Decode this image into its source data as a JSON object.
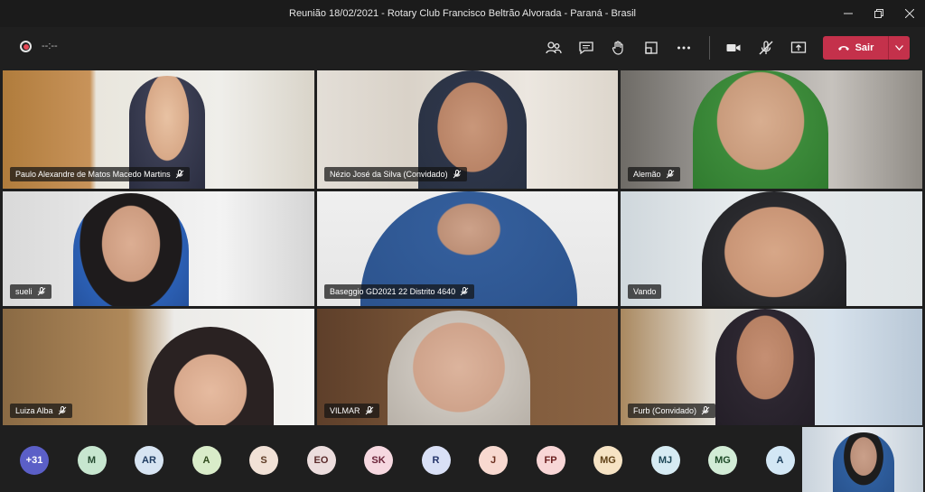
{
  "window": {
    "title": "Reunião 18/02/2021 - Rotary Club Francisco Beltrão Alvorada - Paraná - Brasil"
  },
  "toolbar": {
    "timer": "--:--",
    "leave_label": "Sair"
  },
  "participants": [
    {
      "name": "Paulo Alexandre de Matos Macedo Martins"
    },
    {
      "name": "Nézio José da Silva (Convidado)"
    },
    {
      "name": "Alemão"
    },
    {
      "name": "sueli"
    },
    {
      "name": "Baseggio GD2021 22 Distrito 4640"
    },
    {
      "name": "Vando"
    },
    {
      "name": "Luiza Alba"
    },
    {
      "name": "VILMAR"
    },
    {
      "name": "Furb (Convidado)"
    }
  ],
  "roster": [
    {
      "initials": "+31",
      "bg": "#5b5fc7",
      "fg": "#ffffff"
    },
    {
      "initials": "M",
      "bg": "#c7e6cf",
      "fg": "#24492e"
    },
    {
      "initials": "AR",
      "bg": "#d7e4f2",
      "fg": "#1e3a5f"
    },
    {
      "initials": "A",
      "bg": "#d9ecc9",
      "fg": "#2f4a1c"
    },
    {
      "initials": "S",
      "bg": "#f1e1d6",
      "fg": "#5c3a24"
    },
    {
      "initials": "EO",
      "bg": "#ecdddd",
      "fg": "#5a2b2b"
    },
    {
      "initials": "SK",
      "bg": "#f6d8e0",
      "fg": "#6a2338"
    },
    {
      "initials": "R",
      "bg": "#d9e0f6",
      "fg": "#24346a"
    },
    {
      "initials": "J",
      "bg": "#f8d9d0",
      "fg": "#6a2e1d"
    },
    {
      "initials": "FP",
      "bg": "#f8d6d6",
      "fg": "#6a1e1e"
    },
    {
      "initials": "MG",
      "bg": "#f6e3c4",
      "fg": "#5f4016"
    },
    {
      "initials": "MJ",
      "bg": "#d6ebf3",
      "fg": "#1c4656"
    },
    {
      "initials": "MG",
      "bg": "#d2ecd6",
      "fg": "#1d4a27"
    },
    {
      "initials": "A",
      "bg": "#d3e7f5",
      "fg": "#1d3f5c"
    }
  ],
  "colors": {
    "leave": "#c4314b",
    "accent": "#5b5fc7"
  }
}
